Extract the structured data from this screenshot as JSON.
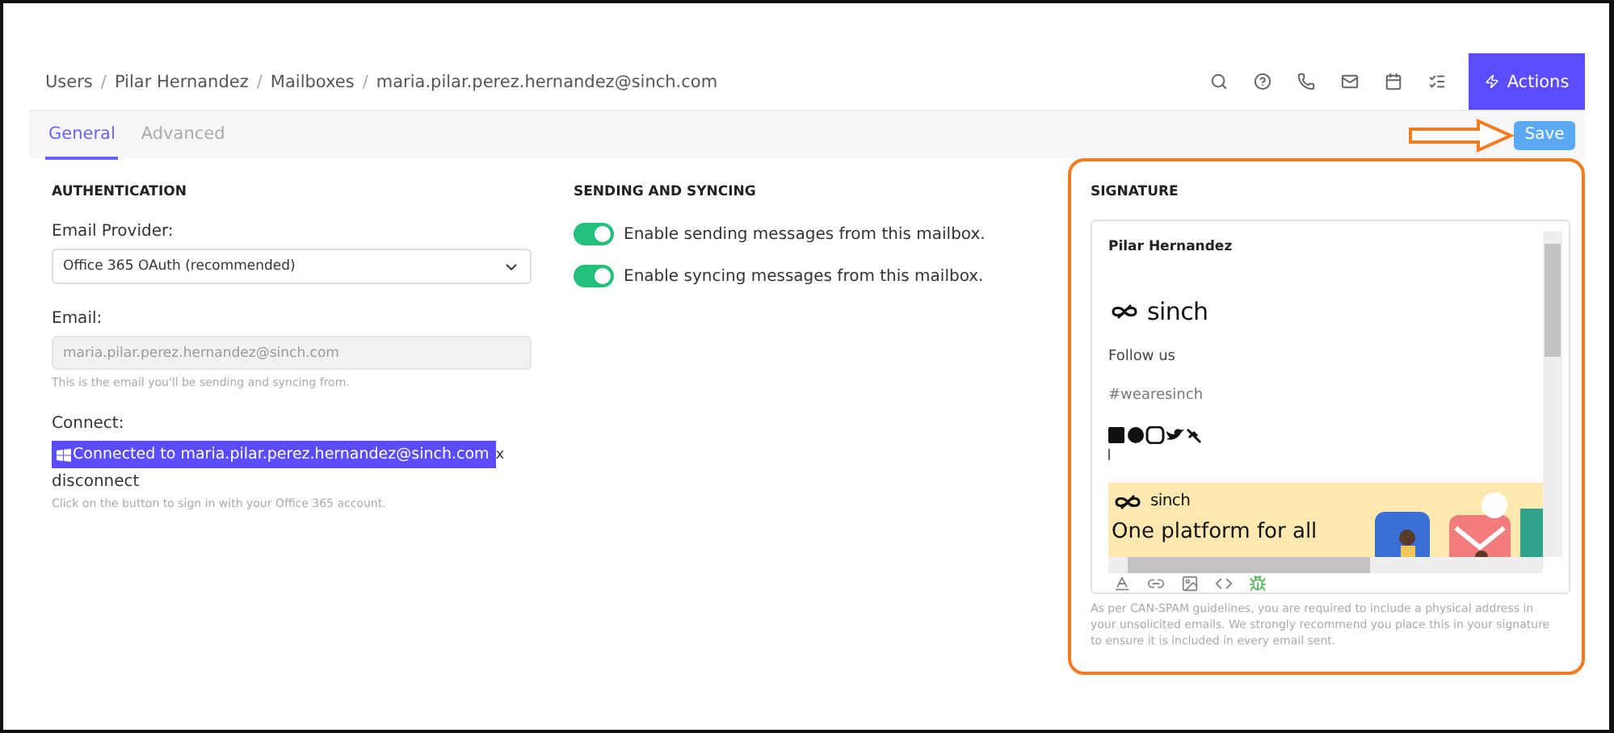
{
  "breadcrumb": {
    "separator": "/",
    "items": [
      "Users",
      "Pilar Hernandez",
      "Mailboxes",
      "maria.pilar.perez.hernandez@sinch.com"
    ]
  },
  "actions_button": {
    "label": "Actions"
  },
  "tabs": [
    {
      "label": "General",
      "selected": true
    },
    {
      "label": "Advanced",
      "selected": false
    }
  ],
  "save_button": {
    "label": "Save"
  },
  "authentication": {
    "title": "AUTHENTICATION",
    "provider_label": "Email Provider:",
    "provider_value": "Office 365 OAuth (recommended)",
    "email_label": "Email:",
    "email_value": "maria.pilar.perez.hernandez@sinch.com",
    "email_hint": "This is the email you'll be sending and syncing from.",
    "connect_label": "Connect:",
    "connect_button": "Connected to maria.pilar.perez.hernandez@sinch.com",
    "close_mark": "x",
    "disconnect": "disconnect",
    "connect_hint": "Click on the button to sign in with your Office 365 account."
  },
  "sending": {
    "title": "SENDING AND SYNCING",
    "toggles": [
      {
        "label": "Enable sending messages from this mailbox.",
        "on": true
      },
      {
        "label": "Enable syncing messages from this mailbox.",
        "on": true
      }
    ]
  },
  "signature": {
    "title": "SIGNATURE",
    "name": "Pilar Hernandez",
    "logo": "sinch",
    "follow": "Follow us",
    "hashtag": "#wearesinch",
    "banner_logo": "sinch",
    "banner_heading": "One platform for all",
    "note": "As per CAN-SPAM guidelines, you are required to include a physical address in your unsolicited emails. We strongly recommend you place this in your signature to ensure it is included in every email sent."
  }
}
